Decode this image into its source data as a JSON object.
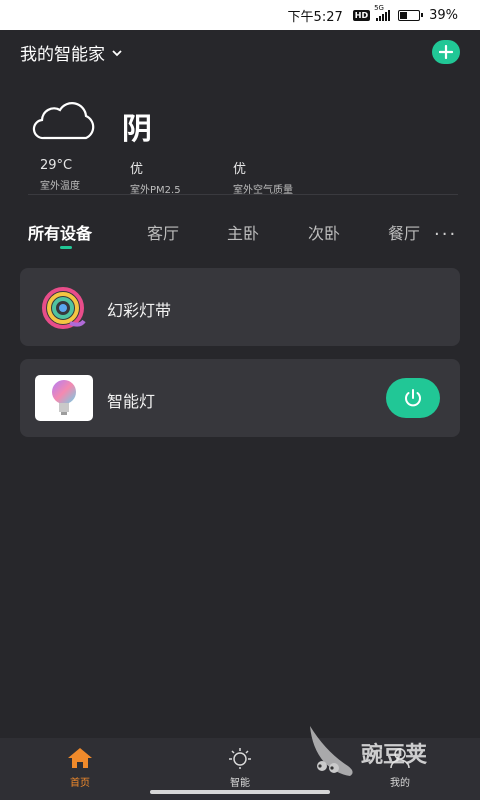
{
  "status_bar": {
    "time": "下午5:27",
    "network": "5G",
    "hd_badge": "HD",
    "battery_percent_text": "39%",
    "battery_level": 0.39
  },
  "header": {
    "home_name": "我的智能家",
    "add_icon": "plus-icon"
  },
  "weather": {
    "condition": "阴",
    "icon": "cloud-icon",
    "stats": [
      {
        "value": "29°C",
        "label": "室外温度"
      },
      {
        "value": "优",
        "label": "室外PM2.5"
      },
      {
        "value": "优",
        "label": "室外空气质量"
      }
    ]
  },
  "tabs": {
    "items": [
      "所有设备",
      "客厅",
      "主卧",
      "次卧",
      "餐厅"
    ],
    "active_index": 0,
    "more_label": "···"
  },
  "devices": [
    {
      "name": "幻彩灯带",
      "icon": "rgb-light-strip-icon"
    },
    {
      "name": "智能灯",
      "icon": "smart-bulb-icon",
      "power_icon": "power-icon"
    }
  ],
  "bottom_nav": {
    "items": [
      {
        "label": "首页",
        "icon": "home-icon",
        "active": true
      },
      {
        "label": "智能",
        "icon": "sun-icon",
        "active": false
      },
      {
        "label": "我的",
        "icon": "user-icon",
        "active": false
      }
    ]
  },
  "watermark": {
    "text": "豌豆荚"
  },
  "colors": {
    "accent": "#21c796",
    "active_nav": "#f08a2b",
    "background": "#27272b",
    "card": "#37373c"
  }
}
